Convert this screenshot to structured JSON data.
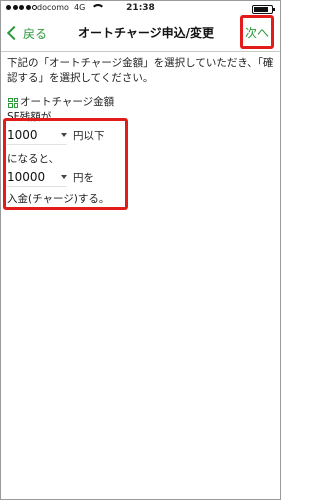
{
  "status": {
    "carrier": "docomo",
    "network": "4G",
    "time": "21:38"
  },
  "nav": {
    "back_label": "戻る",
    "title": "オートチャージ申込/変更",
    "next_label": "次へ"
  },
  "content": {
    "instruction": "下記の「オートチャージ金額」を選択していただき、「確認する」を選択してください。",
    "section_title": "オートチャージ金額",
    "sf_label": "SF残額が",
    "threshold": {
      "value": "1000",
      "unit": "円以下"
    },
    "middle_text": "になると、",
    "charge": {
      "value": "10000",
      "unit": "円を"
    },
    "end_text": "入金(チャージ)する。"
  },
  "colors": {
    "accent": "#2a9a3a",
    "highlight": "#e21b1b"
  }
}
